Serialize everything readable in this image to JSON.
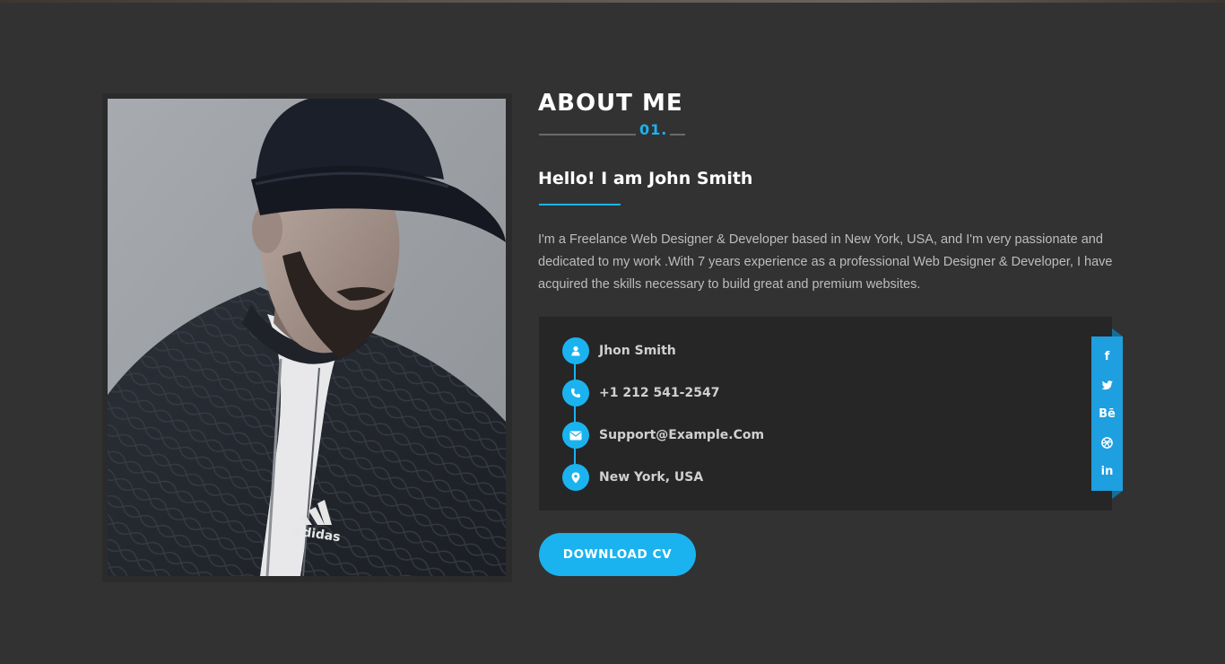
{
  "about": {
    "title": "ABOUT ME",
    "number": "01."
  },
  "intro": {
    "heading": "Hello! I am John Smith",
    "bio": "I'm a Freelance Web Designer & Developer based in New York, USA, and I'm very passionate and dedicated to my work .With 7 years experience as a professional Web Designer & Developer, I have acquired the skills necessary to build great and premium websites."
  },
  "contact": {
    "items": [
      {
        "icon": "user-icon",
        "text": "Jhon Smith"
      },
      {
        "icon": "phone-icon",
        "text": "+1 212 541-2547"
      },
      {
        "icon": "envelope-icon",
        "text": "Support@Example.Com"
      },
      {
        "icon": "map-pin-icon",
        "text": "New York, USA"
      }
    ]
  },
  "social": {
    "links": [
      {
        "icon": "facebook-icon",
        "glyph": "f"
      },
      {
        "icon": "twitter-icon",
        "glyph": ""
      },
      {
        "icon": "behance-icon",
        "glyph": "Bē"
      },
      {
        "icon": "dribbble-icon",
        "glyph": ""
      },
      {
        "icon": "linkedin-icon",
        "glyph": "in"
      }
    ]
  },
  "actions": {
    "download_label": "DOWNLOAD CV"
  },
  "photo": {
    "logo_text": "adidas"
  },
  "colors": {
    "background": "#323232",
    "accent": "#1ab3ef",
    "panel": "#262626",
    "social": "#1e9fe0"
  }
}
